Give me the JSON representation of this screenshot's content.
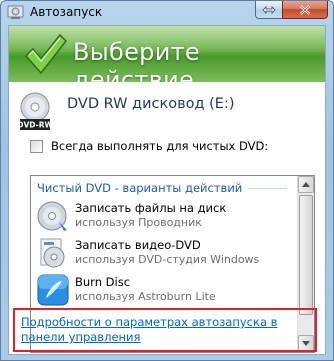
{
  "window": {
    "title": "Автозапуск",
    "title_icon": "autoplay-icon"
  },
  "banner": {
    "title": "Выберите действие",
    "icon": "green-check-icon"
  },
  "device": {
    "name": "DVD RW дисковод (E:)",
    "icon": "dvd-rw-icon",
    "icon_label": "DVD-RW"
  },
  "always_option": {
    "label": "Всегда выполнять для чистых DVD:",
    "checked": false
  },
  "actions_list": {
    "group_header": "Чистый DVD - варианты действий",
    "items": [
      {
        "title": "Записать файлы на диск",
        "subtitle": "используя Проводник",
        "icon": "burn-disc-icon"
      },
      {
        "title": "Записать видео-DVD",
        "subtitle": "используя DVD-студия Windows",
        "icon": "dvd-studio-icon"
      },
      {
        "title": "Burn Disc",
        "subtitle": "используя Astroburn Lite",
        "icon": "astroburn-icon"
      }
    ]
  },
  "footer": {
    "control_panel_link": "Подробности о параметрах автозапуска в панели управления"
  },
  "colors": {
    "banner_green": "#4a9a2d",
    "link_blue": "#0066cc",
    "highlight_red": "#e0202c",
    "header_blue": "#1e5cb3"
  }
}
